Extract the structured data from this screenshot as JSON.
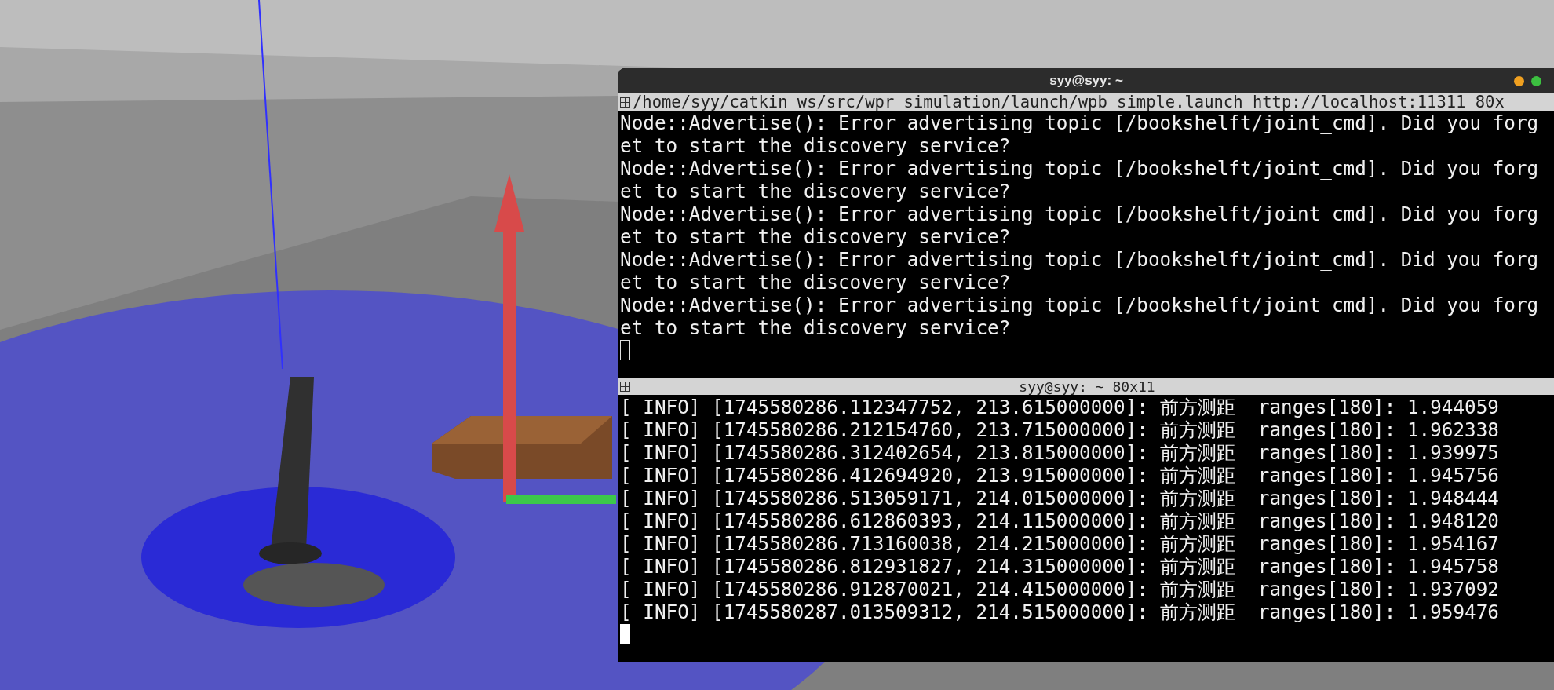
{
  "terminal": {
    "title": "syy@syy: ~",
    "panes": [
      {
        "header": "/home/syy/catkin_ws/src/wpr_simulation/launch/wpb_simple.launch http://localhost:11311 80x",
        "focused": false,
        "lines": [
          "Node::Advertise(): Error advertising topic [/bookshelft/joint_cmd]. Did you forg",
          "et to start the discovery service?",
          "Node::Advertise(): Error advertising topic [/bookshelft/joint_cmd]. Did you forg",
          "et to start the discovery service?",
          "Node::Advertise(): Error advertising topic [/bookshelft/joint_cmd]. Did you forg",
          "et to start the discovery service?",
          "Node::Advertise(): Error advertising topic [/bookshelft/joint_cmd]. Did you forg",
          "et to start the discovery service?",
          "Node::Advertise(): Error advertising topic [/bookshelft/joint_cmd]. Did you forg",
          "et to start the discovery service?"
        ]
      },
      {
        "header": "syy@syy: ~ 80x11",
        "focused": true,
        "lines": [
          "[ INFO] [1745580286.112347752, 213.615000000]: 前方测距  ranges[180]: 1.944059",
          "[ INFO] [1745580286.212154760, 213.715000000]: 前方测距  ranges[180]: 1.962338",
          "[ INFO] [1745580286.312402654, 213.815000000]: 前方测距  ranges[180]: 1.939975",
          "[ INFO] [1745580286.412694920, 213.915000000]: 前方测距  ranges[180]: 1.945756",
          "[ INFO] [1745580286.513059171, 214.015000000]: 前方测距  ranges[180]: 1.948444",
          "[ INFO] [1745580286.612860393, 214.115000000]: 前方测距  ranges[180]: 1.948120",
          "[ INFO] [1745580286.713160038, 214.215000000]: 前方测距  ranges[180]: 1.954167",
          "[ INFO] [1745580286.812931827, 214.315000000]: 前方测距  ranges[180]: 1.945758",
          "[ INFO] [1745580286.912870021, 214.415000000]: 前方测距  ranges[180]: 1.937092",
          "[ INFO] [1745580287.013509312, 214.515000000]: 前方测距  ranges[180]: 1.959476"
        ]
      }
    ]
  }
}
